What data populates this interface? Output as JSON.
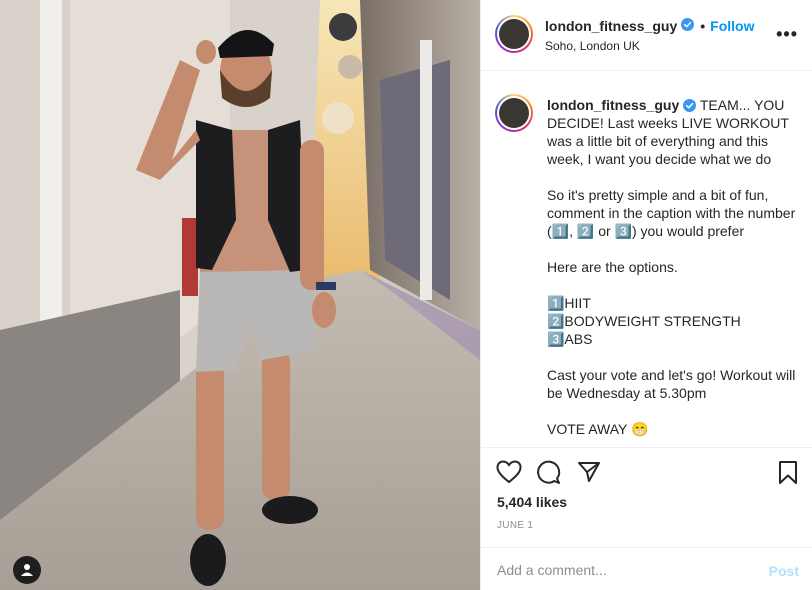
{
  "post": {
    "username": "london_fitness_guy",
    "dot": "•",
    "follow_label": "Follow",
    "location": "Soho, London UK",
    "more_label": "•••",
    "caption": "TEAM... YOU DECIDE! Last weeks LIVE WORKOUT was a little bit of everything and this week, I want you decide what we do\n\nSo it's pretty simple and a bit of fun, comment in the caption with the number (1️⃣, 2️⃣ or 3️⃣) you would prefer\n\nHere are the options.\n\n1️⃣HIIT\n2️⃣BODYWEIGHT STRENGTH\n3️⃣ABS\n\nCast your vote and let's go! Workout will be Wednesday at 5.30pm\n\nVOTE AWAY 😁",
    "likes": "5,404 likes",
    "date": "JUNE 1"
  },
  "comment": {
    "placeholder": "Add a comment...",
    "post_label": "Post"
  },
  "icons": {
    "like": "heart-icon",
    "comment": "comment-icon",
    "share": "paper-plane-icon",
    "save": "bookmark-icon",
    "tags": "user-tag-icon",
    "verified": "verified-badge-icon"
  },
  "colors": {
    "accent": "#0095f6",
    "post_disabled": "#b2dffc",
    "muted": "#8e8e8e",
    "text": "#262626"
  }
}
